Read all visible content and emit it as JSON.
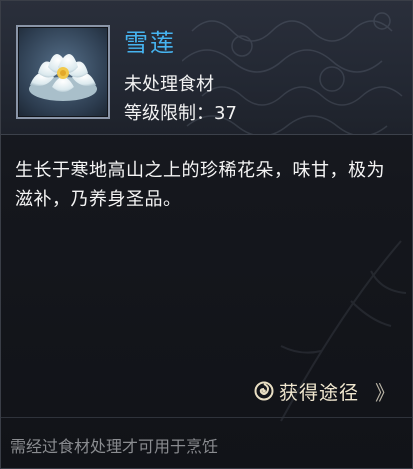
{
  "item": {
    "name": "雪莲",
    "type": "未处理食材",
    "level_label": "等级限制：",
    "level_value": "37",
    "icon": "snow-lotus-icon"
  },
  "description": "生长于寒地高山之上的珍稀花朵，味甘，极为滋补，乃养身圣品。",
  "source": {
    "label": "获得途径",
    "arrow": "》",
    "icon": "spiral-icon"
  },
  "footer_note": "需经过食材处理才可用于烹饪",
  "colors": {
    "name": "#46b4f0",
    "text": "#f4f4f4",
    "footer": "#8a8c90",
    "source": "#f0e7cf",
    "background": "#15171d"
  }
}
